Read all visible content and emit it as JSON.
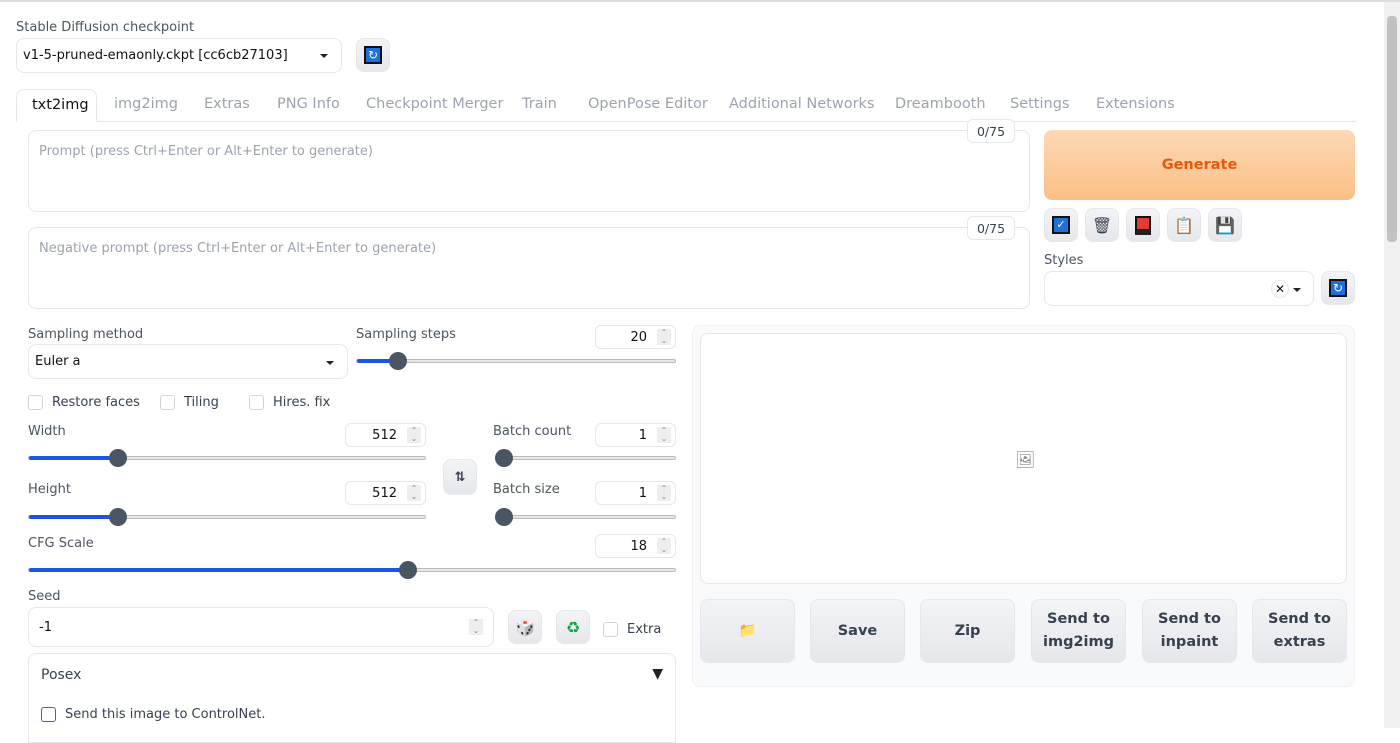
{
  "checkpoint": {
    "label": "Stable Diffusion checkpoint",
    "value": "v1-5-pruned-emaonly.ckpt [cc6cb27103]",
    "refresh_icon": "refresh-icon"
  },
  "tabs": [
    {
      "label": "txt2img",
      "active": true
    },
    {
      "label": "img2img"
    },
    {
      "label": "Extras"
    },
    {
      "label": "PNG Info"
    },
    {
      "label": "Checkpoint Merger"
    },
    {
      "label": "Train"
    },
    {
      "label": "OpenPose Editor"
    },
    {
      "label": "Additional Networks"
    },
    {
      "label": "Dreambooth"
    },
    {
      "label": "Settings"
    },
    {
      "label": "Extensions"
    }
  ],
  "prompt": {
    "placeholder": "Prompt (press Ctrl+Enter or Alt+Enter to generate)",
    "counter": "0/75"
  },
  "negative_prompt": {
    "placeholder": "Negative prompt (press Ctrl+Enter or Alt+Enter to generate)",
    "counter": "0/75"
  },
  "generate": {
    "label": "Generate",
    "color": "#f97316"
  },
  "tool_icons": [
    "paint-brush-icon",
    "trash-icon",
    "red-card-icon",
    "clipboard-icon",
    "floppy-disk-icon"
  ],
  "styles": {
    "label": "Styles",
    "value": ""
  },
  "sampling": {
    "method_label": "Sampling method",
    "method": "Euler a",
    "steps_label": "Sampling steps",
    "steps": 20,
    "steps_range": [
      1,
      150
    ]
  },
  "checkboxes": {
    "restore_faces": "Restore faces",
    "tiling": "Tiling",
    "hires": "Hires. fix"
  },
  "width": {
    "label": "Width",
    "value": 512,
    "range": [
      64,
      2048
    ]
  },
  "height": {
    "label": "Height",
    "value": 512,
    "range": [
      64,
      2048
    ]
  },
  "batch_count": {
    "label": "Batch count",
    "value": 1,
    "range": [
      1,
      100
    ]
  },
  "batch_size": {
    "label": "Batch size",
    "value": 1,
    "range": [
      1,
      8
    ]
  },
  "cfg": {
    "label": "CFG Scale",
    "value": 18,
    "range": [
      1,
      30
    ]
  },
  "seed": {
    "label": "Seed",
    "value": "-1",
    "extra": "Extra"
  },
  "posex": {
    "title": "Posex",
    "send": "Send this image to ControlNet."
  },
  "output_buttons": [
    {
      "label": "Save"
    },
    {
      "label": "Zip"
    },
    {
      "label": "Send to img2img"
    },
    {
      "label": "Send to inpaint"
    },
    {
      "label": "Send to extras"
    }
  ]
}
